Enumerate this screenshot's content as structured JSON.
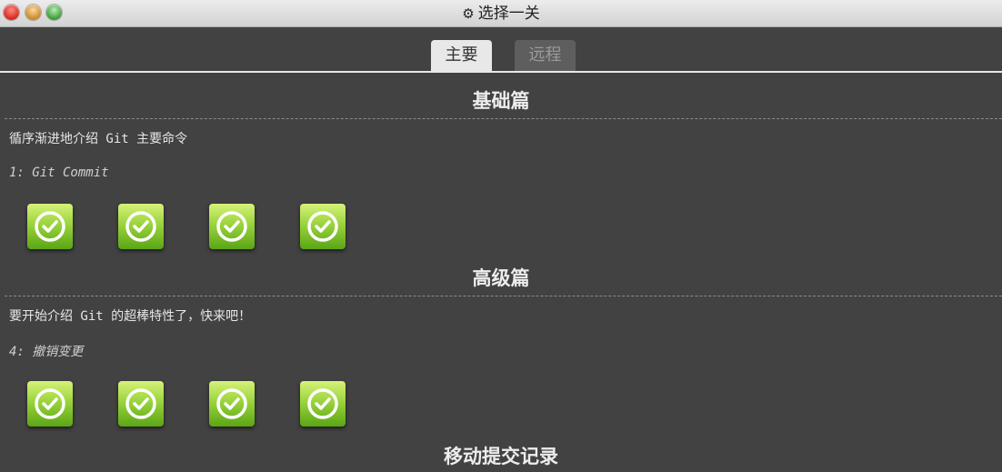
{
  "window": {
    "title": "选择一关",
    "icon": "gear-icon"
  },
  "tabs": [
    {
      "label": "主要",
      "active": true
    },
    {
      "label": "远程",
      "active": false
    }
  ],
  "sections": [
    {
      "title": "基础篇",
      "description": "循序渐进地介绍 Git 主要命令",
      "sequence_name": "1: Git Commit",
      "levels": [
        {
          "completed": true,
          "icon": "check-circle-icon"
        },
        {
          "completed": true,
          "icon": "check-circle-icon"
        },
        {
          "completed": true,
          "icon": "check-circle-icon"
        },
        {
          "completed": true,
          "icon": "check-circle-icon"
        }
      ]
    },
    {
      "title": "高级篇",
      "description": "要开始介绍 Git 的超棒特性了，快来吧！",
      "sequence_name": "4: 撤销变更",
      "levels": [
        {
          "completed": true,
          "icon": "check-circle-icon"
        },
        {
          "completed": true,
          "icon": "check-circle-icon"
        },
        {
          "completed": true,
          "icon": "check-circle-icon"
        },
        {
          "completed": true,
          "icon": "check-circle-icon"
        }
      ]
    },
    {
      "title": "移动提交记录"
    }
  ],
  "colors": {
    "background": "#424242",
    "level_complete_top": "#d6f27a",
    "level_complete_bottom": "#5aa515"
  }
}
